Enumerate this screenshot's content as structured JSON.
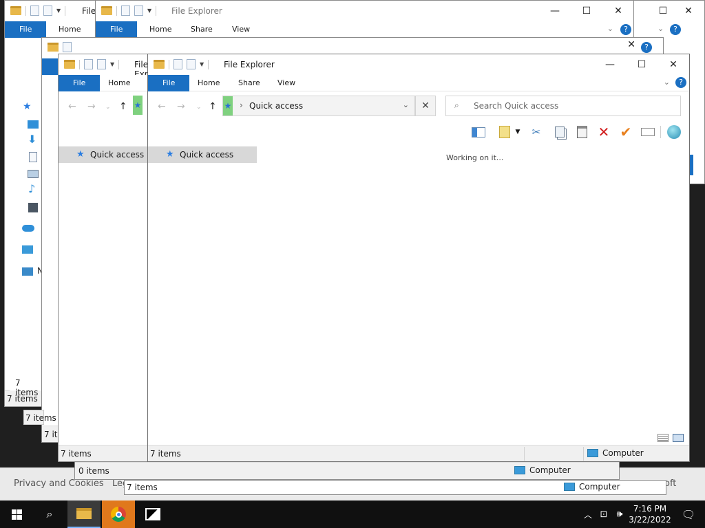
{
  "app_name": "File Explorer",
  "ribbon_tabs": [
    "File",
    "Home",
    "Share",
    "View"
  ],
  "location": "Quick access",
  "search_placeholder": "Search Quick access",
  "status": {
    "working": "Working on it...",
    "items_7": "7 items",
    "items_0": "0 items",
    "computer": "Computer"
  },
  "background": {
    "privacy": "Privacy and Cookies",
    "legal_fragment": "Leg",
    "soft_fragment": "oft",
    "sidebar_fragment": "N"
  },
  "taskbar": {
    "time": "7:16 PM",
    "date": "3/22/2022"
  },
  "colors": {
    "ribbon_file": "#1a6fc2",
    "taskbar": "#101010",
    "selection": "#d8d8d8"
  }
}
